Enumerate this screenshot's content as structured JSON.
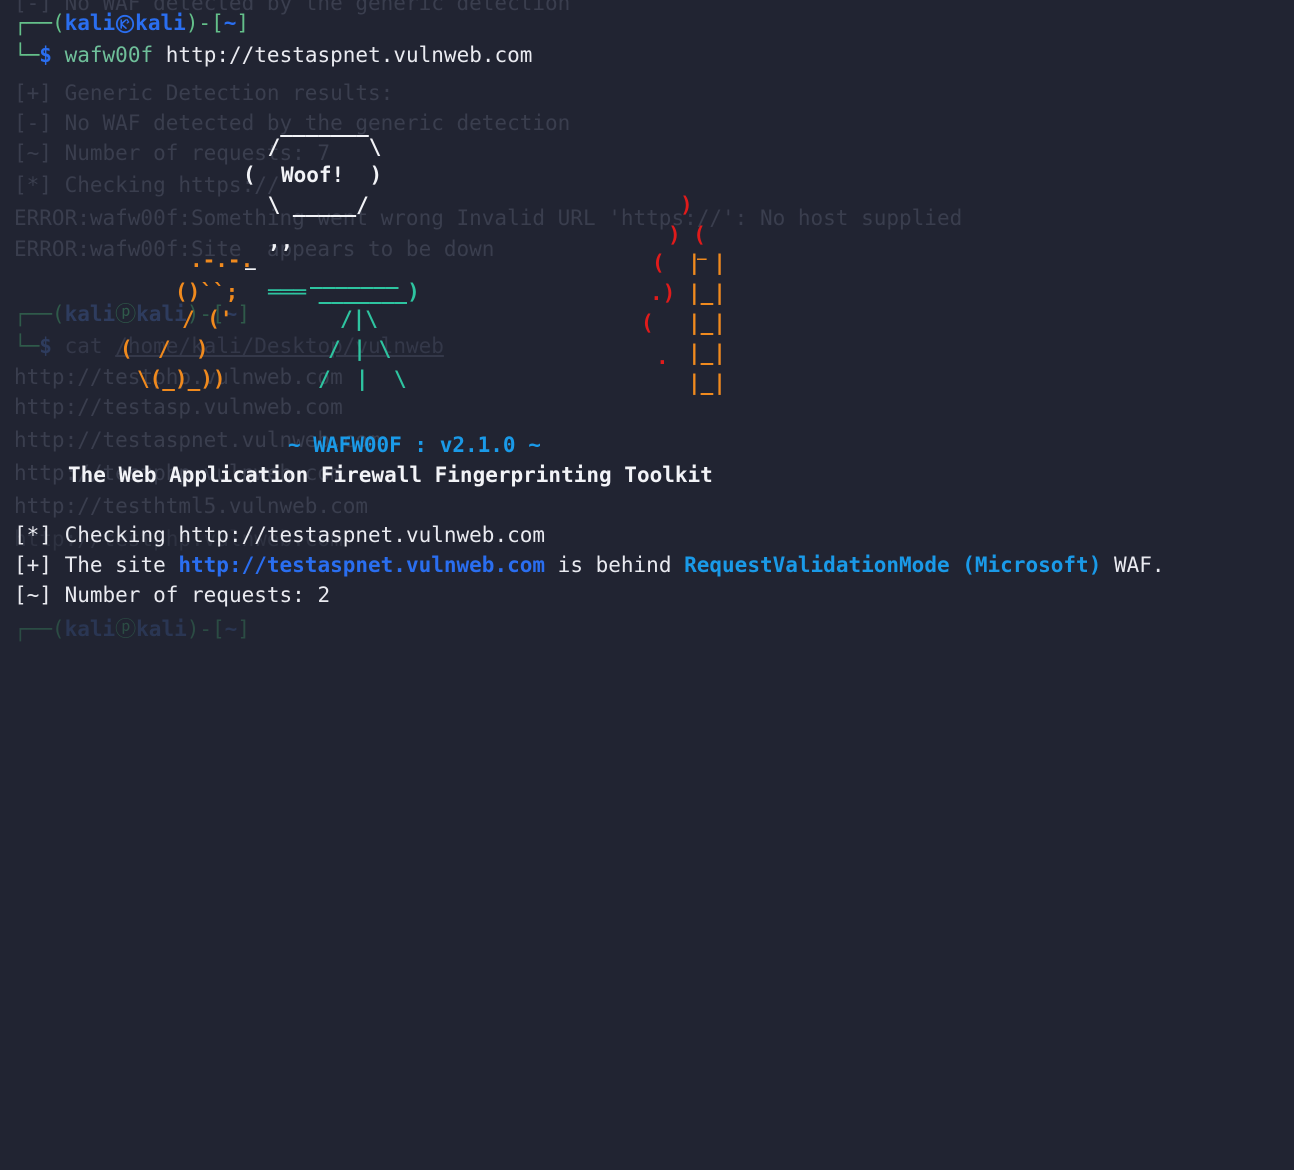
{
  "terminal": {
    "background_color": "#212432",
    "foreground_color": "#e9eaf0",
    "font_size_px": 21,
    "line_height_px": 30,
    "columns": 105,
    "rows": 21
  },
  "colors": {
    "prompt_paren_green": "#64c08a",
    "prompt_user_blue": "#2a6ef0",
    "command_green": "#6fbf9a",
    "link_blue": "#2a6ef0",
    "accent_bright_blue": "#1a9ae8",
    "art_white": "#f2f3f7",
    "art_orange": "#f08a1e",
    "art_teal": "#2ec4a0",
    "art_red": "#e01b1b",
    "ghost_faded": "#3a3e4e"
  },
  "prompt": {
    "top_corner": "┌──",
    "open_paren": "(",
    "user": "kali",
    "at_icon": "kali-dragon-logo-icon",
    "host": "kali",
    "close_paren": ")",
    "dash": "-",
    "open_bracket": "[",
    "cwd": "~",
    "close_bracket": "]",
    "bottom_corner": "└─",
    "sigil": "$"
  },
  "command": {
    "program": "wafw00f",
    "argument": "http://testaspnet.vulnweb.com",
    "full": "wafw00f http://testaspnet.vulnweb.com"
  },
  "ghost_scrollback": {
    "description": "Faded previous-screen text visible behind the current output",
    "lines": [
      "[-] No WAF detected by the generic detection",
      "",
      "",
      "[+] Generic Detection results:",
      "[-] No WAF detected by the generic detection",
      "[~] Number of requests: 7",
      "[*] Checking https://",
      "ERROR:wafw00f:Something went wrong Invalid URL 'https://': No host supplied",
      "ERROR:wafw00f:Site  appears to be down",
      "",
      "┌──(kali㉿kali)-[~]",
      "└─$ cat /home/kali/Desktop/vulnweb",
      "http://testphp.vulnweb.com",
      "http://testasp.vulnweb.com",
      "http://testaspnet.vulnweb.com",
      "http://testphp.vulnweb.com",
      "http://testhtml5.vulnweb.com",
      "",
      "",
      "",
      "┌──(kali㉿kali)-[~]"
    ]
  },
  "ascii_art": {
    "name": "wafw00f-dog-banner",
    "speech_bubble_text": "Woof!",
    "lines": [
      "                 _______",
      "               /        \\",
      "              ( Woof!    )",
      "               \\  ______/",
      "                ,,    ",
      "        __      .-.-.   _",
      "       ()``;   |====|    )",
      "       / ('        /|\\",
      "   (  /  )        / | \\",
      "    \\(_)_))      /  |  \\"
    ]
  },
  "banner": {
    "title_prefix": "~",
    "title": "WAFW00F",
    "separator": ":",
    "version": "v2.1.0",
    "title_suffix": "~",
    "full_title": "~ WAFW00F : v2.1.0 ~",
    "subtitle": "The Web Application Firewall Fingerprinting Toolkit"
  },
  "output": {
    "lines": [
      {
        "marker": "[*]",
        "text_before": " Checking ",
        "target": "http://testaspnet.vulnweb.com",
        "target_style": "plain",
        "text_after": ""
      },
      {
        "marker": "[+]",
        "text_before": " The site ",
        "target": "http://testaspnet.vulnweb.com",
        "target_style": "link",
        "middle": " is behind ",
        "waf_name": "RequestValidationMode (Microsoft)",
        "text_after": " WAF."
      },
      {
        "marker": "[~]",
        "text_before": " Number of requests: ",
        "value": "2",
        "text_after": ""
      }
    ],
    "checking_line": "[*] Checking http://testaspnet.vulnweb.com",
    "result_line": "[+] The site http://testaspnet.vulnweb.com is behind RequestValidationMode (Microsoft) WAF.",
    "requests_line": "[~] Number of requests: 2",
    "waf_detected": "RequestValidationMode (Microsoft)",
    "request_count": "2"
  }
}
